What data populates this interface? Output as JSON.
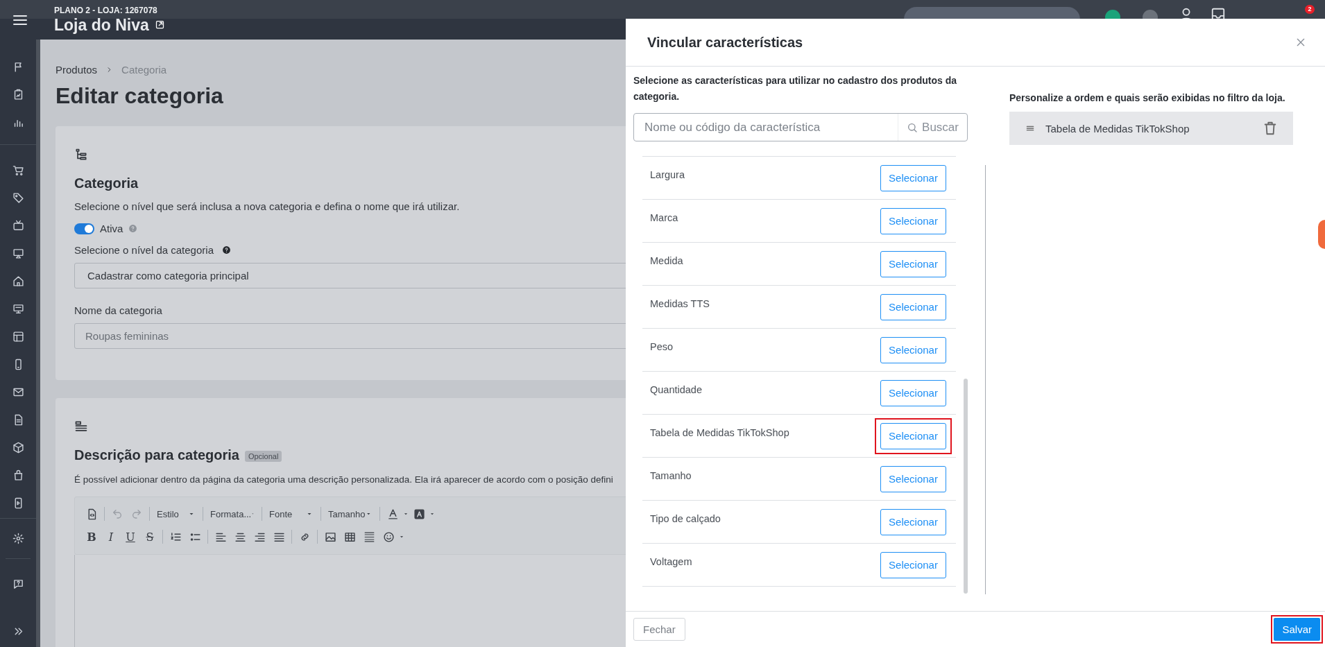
{
  "header": {
    "plan": "PLANO 2 - LOJA: 1267078",
    "store_name": "Loja do Niva",
    "notification_count": "2"
  },
  "breadcrumb": [
    "Produtos",
    "Categoria"
  ],
  "page_title": "Editar categoria",
  "category_card": {
    "title": "Categoria",
    "description": "Selecione o nível que será inclusa a nova categoria e defina o nome que irá utilizar.",
    "active_toggle": {
      "label": "Ativa",
      "on": true
    },
    "level_field": {
      "label": "Selecione o nível da categoria",
      "value": "Cadastrar como categoria principal"
    },
    "name_field": {
      "label": "Nome da categoria",
      "value": "Roupas femininas"
    }
  },
  "description_card": {
    "title": "Descrição para categoria",
    "badge": "Opcional",
    "text": "É possível adicionar dentro da página da categoria uma descrição personalizada. Ela irá aparecer de acordo com o posição defini",
    "editor": {
      "dropdowns": [
        "Estilo",
        "Formata...",
        "Fonte",
        "Tamanho"
      ],
      "format_buttons": [
        "B",
        "I",
        "U",
        "S"
      ]
    }
  },
  "modal": {
    "title": "Vincular características",
    "intro": "Selecione as características para utilizar no cadastro dos produtos da categoria.",
    "search": {
      "placeholder": "Nome ou código da característica",
      "button": "Buscar"
    },
    "characteristics": [
      {
        "name": "Largura",
        "button": "Selecionar",
        "highlighted": false
      },
      {
        "name": "Marca",
        "button": "Selecionar",
        "highlighted": false
      },
      {
        "name": "Medida",
        "button": "Selecionar",
        "highlighted": false
      },
      {
        "name": "Medidas TTS",
        "button": "Selecionar",
        "highlighted": false
      },
      {
        "name": "Peso",
        "button": "Selecionar",
        "highlighted": false
      },
      {
        "name": "Quantidade",
        "button": "Selecionar",
        "highlighted": false
      },
      {
        "name": "Tabela de Medidas TikTokShop",
        "button": "Selecionar",
        "highlighted": true
      },
      {
        "name": "Tamanho",
        "button": "Selecionar",
        "highlighted": false
      },
      {
        "name": "Tipo de calçado",
        "button": "Selecionar",
        "highlighted": false
      },
      {
        "name": "Voltagem",
        "button": "Selecionar",
        "highlighted": false
      }
    ],
    "selected_panel": {
      "hint": "Personalize a ordem e quais serão exibidas no filtro da loja.",
      "items": [
        {
          "name": "Tabela de Medidas TikTokShop"
        }
      ]
    },
    "footer": {
      "close": "Fechar",
      "save": {
        "label": "Salvar",
        "highlighted": true
      }
    }
  }
}
